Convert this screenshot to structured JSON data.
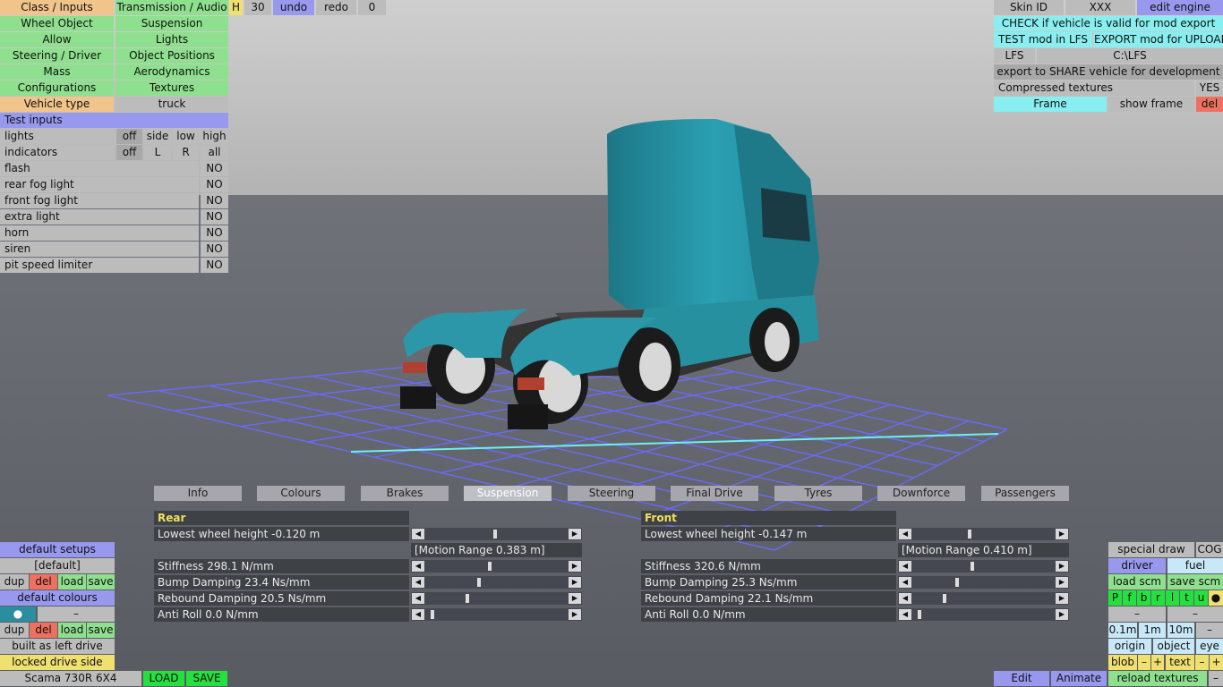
{
  "top_left": {
    "class_inputs": "Class / Inputs",
    "transmission_audio": "Transmission / Audio",
    "h": "H",
    "thirty": "30",
    "undo": "undo",
    "redo": "redo",
    "zero": "0",
    "wheel_object": "Wheel Object",
    "suspension": "Suspension",
    "allow": "Allow",
    "lights": "Lights",
    "steering_driver": "Steering / Driver",
    "object_positions": "Object Positions",
    "mass": "Mass",
    "aerodynamics": "Aerodynamics",
    "configurations": "Configurations",
    "textures": "Textures",
    "vehicle_type": "Vehicle type",
    "vehicle_type_value": "truck"
  },
  "test_inputs": {
    "title": "Test inputs",
    "lights_label": "lights",
    "lights_opts": [
      "off",
      "side",
      "low",
      "high"
    ],
    "indicators_label": "indicators",
    "indicators_opts": [
      "off",
      "L",
      "R",
      "all"
    ],
    "rows": [
      {
        "label": "flash",
        "value": "NO"
      },
      {
        "label": "rear fog light",
        "value": "NO"
      },
      {
        "label": "front fog light",
        "value": "NO"
      },
      {
        "label": "extra light",
        "value": "NO"
      },
      {
        "label": "horn",
        "value": "NO"
      },
      {
        "label": "siren",
        "value": "NO"
      },
      {
        "label": "pit speed limiter",
        "value": "NO"
      }
    ]
  },
  "top_right": {
    "skin_id": "Skin ID",
    "skin_value": "XXX",
    "edit_engine": "edit engine",
    "check": "CHECK if vehicle is valid for mod export",
    "test": "TEST mod in LFS",
    "export": "EXPORT mod for UPLOAD",
    "lfs": "LFS",
    "path": "C:\\LFS",
    "share": "export to SHARE vehicle for development",
    "compressed": "Compressed textures",
    "compressed_value": "YES",
    "frame": "Frame",
    "show_frame": "show frame",
    "del": "del"
  },
  "tabs": [
    "Info",
    "Colours",
    "Brakes",
    "Suspension",
    "Steering",
    "Final Drive",
    "Tyres",
    "Downforce",
    "Passengers"
  ],
  "active_tab": "Suspension",
  "rear": {
    "title": "Rear",
    "lowest": "Lowest wheel height -0.120 m",
    "motion": "[Motion Range 0.383 m]",
    "stiffness": "Stiffness 298.1 N/mm",
    "bump": "Bump Damping 23.4 Ns/mm",
    "rebound": "Rebound Damping 20.5 Ns/mm",
    "antiroll": "Anti Roll 0.0 N/mm"
  },
  "front": {
    "title": "Front",
    "lowest": "Lowest wheel height -0.147 m",
    "motion": "[Motion Range 0.410 m]",
    "stiffness": "Stiffness 320.6 N/mm",
    "bump": "Bump Damping 25.3 Ns/mm",
    "rebound": "Rebound Damping 22.1 Ns/mm",
    "antiroll": "Anti Roll 0.0 N/mm"
  },
  "slider_levels": {
    "rear_lowest": 0.5,
    "rear_stiffness": 0.46,
    "rear_bump": 0.37,
    "rear_rebound": 0.28,
    "rear_antiroll": 0.0,
    "front_lowest": 0.4,
    "front_stiffness": 0.42,
    "front_bump": 0.3,
    "front_rebound": 0.2,
    "front_antiroll": 0.0
  },
  "bottom_left": {
    "default_setups": "default setups",
    "default_value": "[default]",
    "dup": "dup",
    "del": "del",
    "load": "load",
    "save": "save",
    "default_colours": "default colours",
    "dot": "●",
    "dash": "–",
    "built_as": "built as left drive",
    "locked": "locked drive side",
    "vehicle_name": "Scama 730R 6X4",
    "load_btn": "LOAD",
    "save_btn": "SAVE"
  },
  "bottom_right": {
    "special_draw": "special draw",
    "cog": "COG",
    "driver": "driver",
    "fuel": "fuel",
    "load_scm": "load scm",
    "save_scm": "save scm",
    "letters": [
      "P",
      "f",
      "b",
      "r",
      "l",
      "t",
      "u",
      "●"
    ],
    "dash": "–",
    "m01": "0.1m",
    "m1": "1m",
    "m10": "10m",
    "origin": "origin",
    "object": "object",
    "eye": "eye",
    "blob": "blob",
    "minus": "–",
    "plus": "+",
    "text": "text",
    "edit": "Edit",
    "animate": "Animate",
    "reload": "reload textures"
  },
  "colors": {
    "vehicle": "#2e8f9f",
    "grid": "#6a6aff",
    "grid_axis": "#6ff0f0",
    "sky": "#c0c0c0",
    "floor": "#5f6169"
  }
}
